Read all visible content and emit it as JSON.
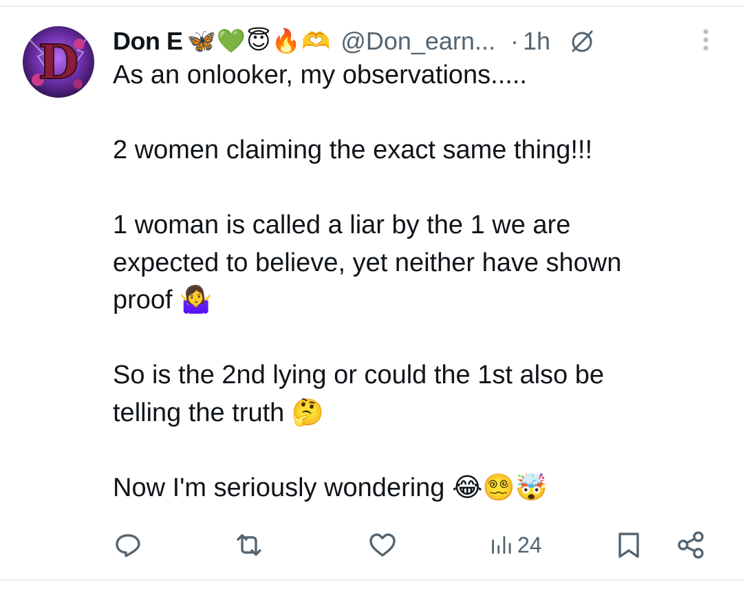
{
  "tweet": {
    "author": {
      "display_name": "Don E",
      "name_emojis": "🦋💚😇🔥🫶",
      "handle": "@Don_earn...",
      "avatar_letter": "D"
    },
    "separator": "·",
    "time": "1h",
    "text_lines": [
      "As an onlooker, my observations.....",
      "",
      "2 women claiming the exact same thing!!!",
      "",
      "1 woman is called a liar by the 1 we are",
      "expected to believe, yet neither have shown",
      "proof 🤷‍♀️",
      "",
      "So is the 2nd lying or could the 1st also be",
      "telling the truth 🤔",
      "",
      "Now I'm seriously wondering 😂😵‍💫🤯"
    ],
    "stats": {
      "views": "24"
    }
  },
  "colors": {
    "text": "#0f1419",
    "muted": "#536471",
    "divider": "#e6ecf0",
    "avatar_bg": "#6b2fa8"
  },
  "icons": {
    "mute": "mute-icon",
    "more": "more-vertical-icon",
    "reply": "reply-icon",
    "retweet": "retweet-icon",
    "like": "heart-icon",
    "views": "views-bar-icon",
    "bookmark": "bookmark-icon",
    "share": "share-icon"
  }
}
